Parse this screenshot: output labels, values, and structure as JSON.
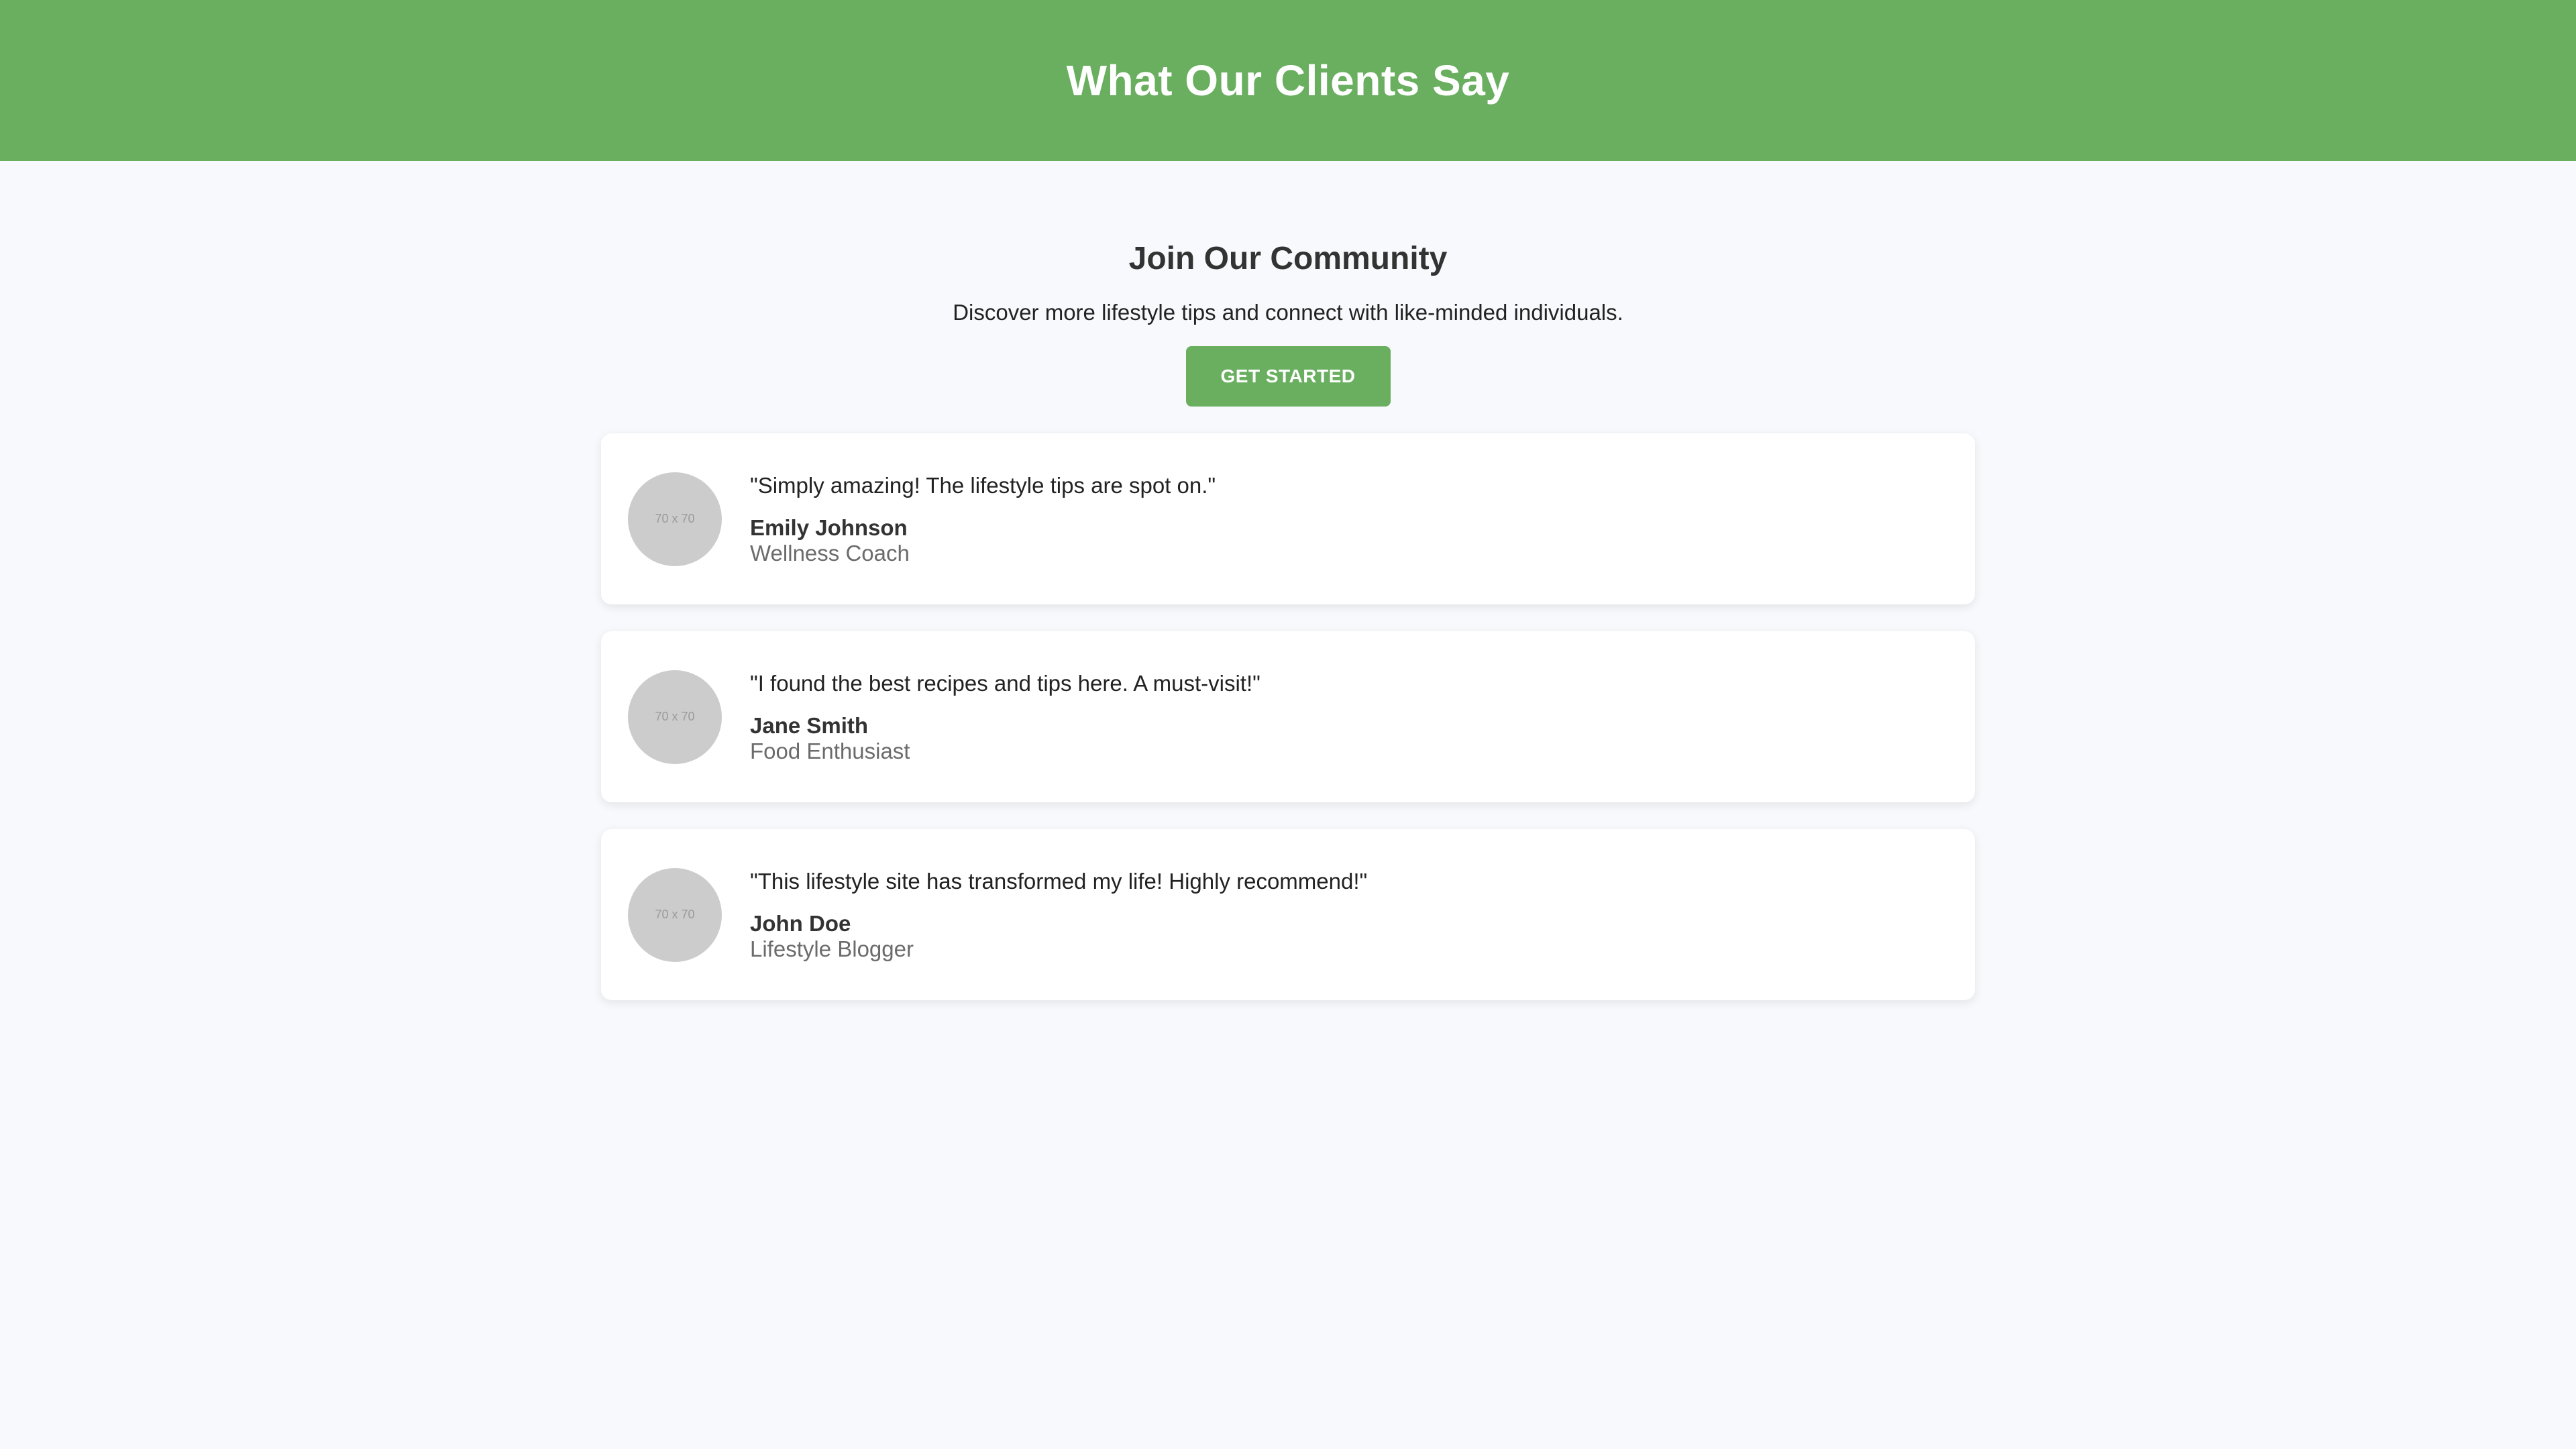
{
  "header": {
    "title": "What Our Clients Say"
  },
  "community": {
    "heading": "Join Our Community",
    "description": "Discover more lifestyle tips and connect with like-minded individuals.",
    "cta_label": "GET STARTED"
  },
  "testimonials": [
    {
      "avatar_text": "70 x 70",
      "quote": "\"Simply amazing! The lifestyle tips are spot on.\"",
      "author": "Emily Johnson",
      "role": "Wellness Coach"
    },
    {
      "avatar_text": "70 x 70",
      "quote": "\"I found the best recipes and tips here. A must-visit!\"",
      "author": "Jane Smith",
      "role": "Food Enthusiast"
    },
    {
      "avatar_text": "70 x 70",
      "quote": "\"This lifestyle site has transformed my life! Highly recommend!\"",
      "author": "John Doe",
      "role": "Lifestyle Blogger"
    }
  ],
  "colors": {
    "brand_green": "#69af5f",
    "page_background": "#f7f9fc",
    "card_background": "#ffffff",
    "avatar_placeholder": "#cccccc"
  }
}
